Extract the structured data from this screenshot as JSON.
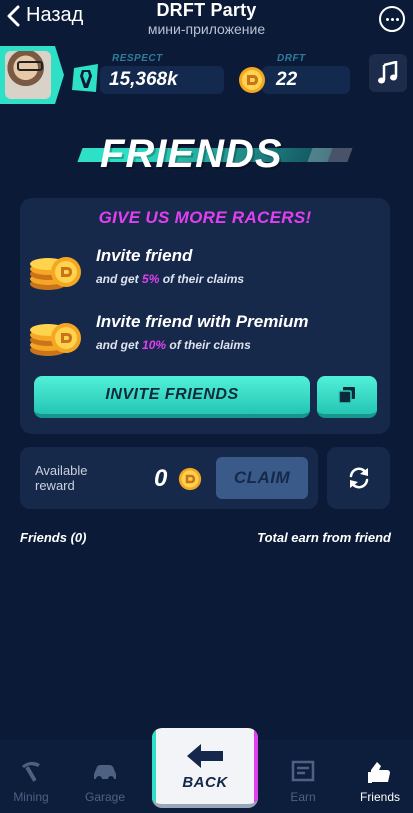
{
  "tg": {
    "back_label": "Назад",
    "title": "DRFT Party",
    "subtitle": "мини-приложение"
  },
  "stats": {
    "respect_label": "RESPECT",
    "respect_value": "15,368k",
    "drft_label": "DRFT",
    "drft_value": "22"
  },
  "page": {
    "title": "FRIENDS"
  },
  "invite": {
    "heading": "GIVE US MORE RACERS!",
    "items": [
      {
        "title": "Invite friend",
        "sub_before": "and get ",
        "pct": "5%",
        "sub_after": " of their claims"
      },
      {
        "title": "Invite friend with Premium",
        "sub_before": "and get ",
        "pct": "10%",
        "sub_after": " of their claims"
      }
    ],
    "button_label": "INVITE FRIENDS"
  },
  "reward": {
    "label": "Available reward",
    "value": "0",
    "claim_label": "CLAIM"
  },
  "friends": {
    "count_label": "Friends (0)",
    "total_label": "Total earn from friend"
  },
  "nav": {
    "mining": "Mining",
    "garage": "Garage",
    "back": "BACK",
    "earn": "Earn",
    "friends": "Friends"
  },
  "colors": {
    "background": "#0b1a37",
    "card": "#17294b",
    "accent_teal": "#2de0c6",
    "accent_magenta": "#e040f0",
    "claim_disabled": "#3a5a8a"
  }
}
